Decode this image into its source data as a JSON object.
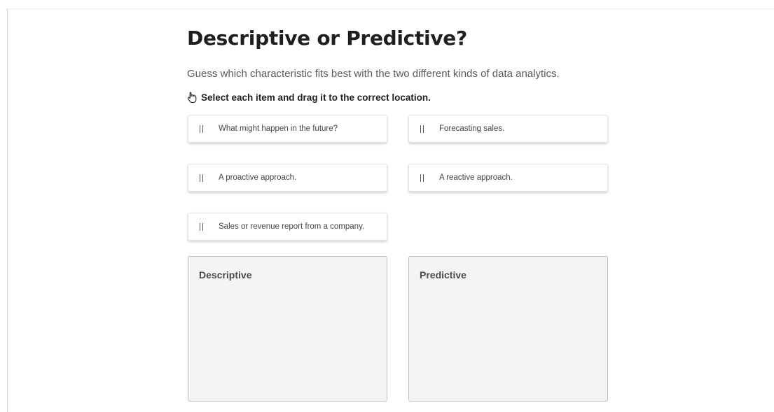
{
  "title": "Descriptive or Predictive?",
  "subtitle": "Guess which characteristic fits best with the two different kinds of data analytics.",
  "instruction": {
    "icon": "pointer-hand-icon",
    "text": "Select each item and drag it to the correct location."
  },
  "items": [
    {
      "label": "What might happen in the future?"
    },
    {
      "label": "Forecasting sales."
    },
    {
      "label": "A proactive approach."
    },
    {
      "label": "A reactive approach."
    },
    {
      "label": "Sales or revenue report from a company."
    }
  ],
  "dropzones": [
    {
      "title": "Descriptive"
    },
    {
      "title": "Predictive"
    }
  ],
  "colors": {
    "dropzone_bg": "#f4f4f4",
    "text_dark": "#1f1f1f",
    "text_muted": "#5a5a5a"
  }
}
